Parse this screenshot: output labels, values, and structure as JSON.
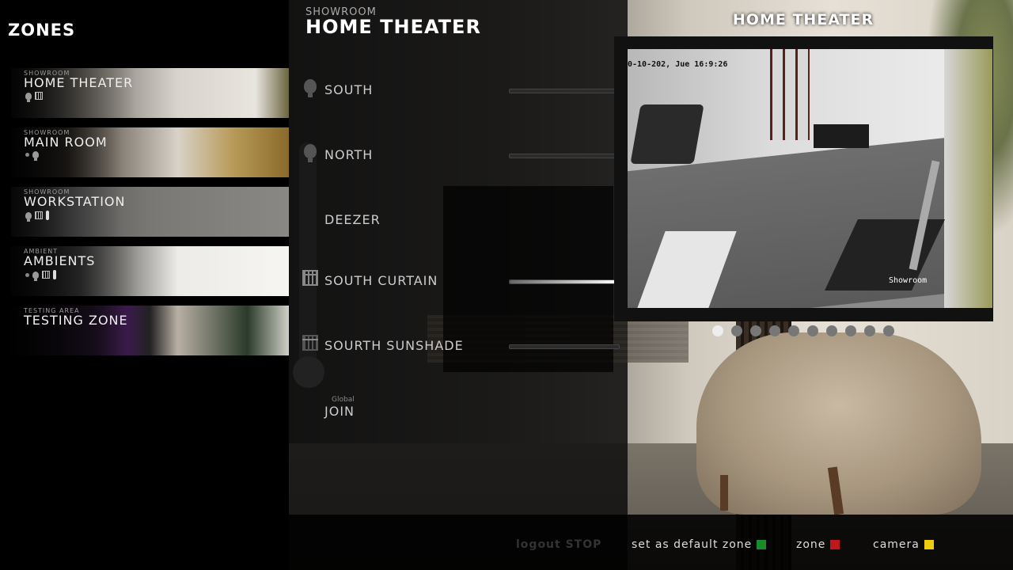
{
  "zones_panel": {
    "title": "ZONES",
    "zones": [
      {
        "category": "SHOWROOM",
        "name": "HOME THEATER"
      },
      {
        "category": "SHOWROOM",
        "name": "MAIN ROOM"
      },
      {
        "category": "SHOWROOM",
        "name": "WORKSTATION"
      },
      {
        "category": "AMBIENT",
        "name": "AMBIENTS"
      },
      {
        "category": "TESTING AREA",
        "name": "TESTING ZONE"
      }
    ]
  },
  "detail": {
    "subtitle": "SHOWROOM",
    "title": "HOME THEATER",
    "controls": [
      {
        "label": "SOUTH",
        "icon": "bulb-icon",
        "slider_level": 0.0
      },
      {
        "label": "NORTH",
        "icon": "bulb-icon",
        "slider_level": 0.0
      },
      {
        "label": "DEEZER",
        "icon": "none"
      },
      {
        "label": "SOUTH CURTAIN",
        "icon": "curtain-icon",
        "slider_level": 1.0
      },
      {
        "label": "SOURTH SUNSHADE",
        "icon": "curtain-icon",
        "slider_level": 0.0
      }
    ],
    "global_label": "Global",
    "join_label": "JOIN"
  },
  "camera": {
    "title": "HOME THEATER",
    "timestamp": "0-10-202, Jue 16:9:26",
    "overlay_label": "Showroom",
    "pages": 10,
    "active_page": 1
  },
  "bottom_bar": {
    "logout": "logout STOP",
    "default_zone": "set as default zone",
    "zone": "zone",
    "camera": "camera",
    "colors": {
      "default_zone": "#1a8a2a",
      "zone": "#c01818",
      "camera": "#f0cc10"
    }
  }
}
